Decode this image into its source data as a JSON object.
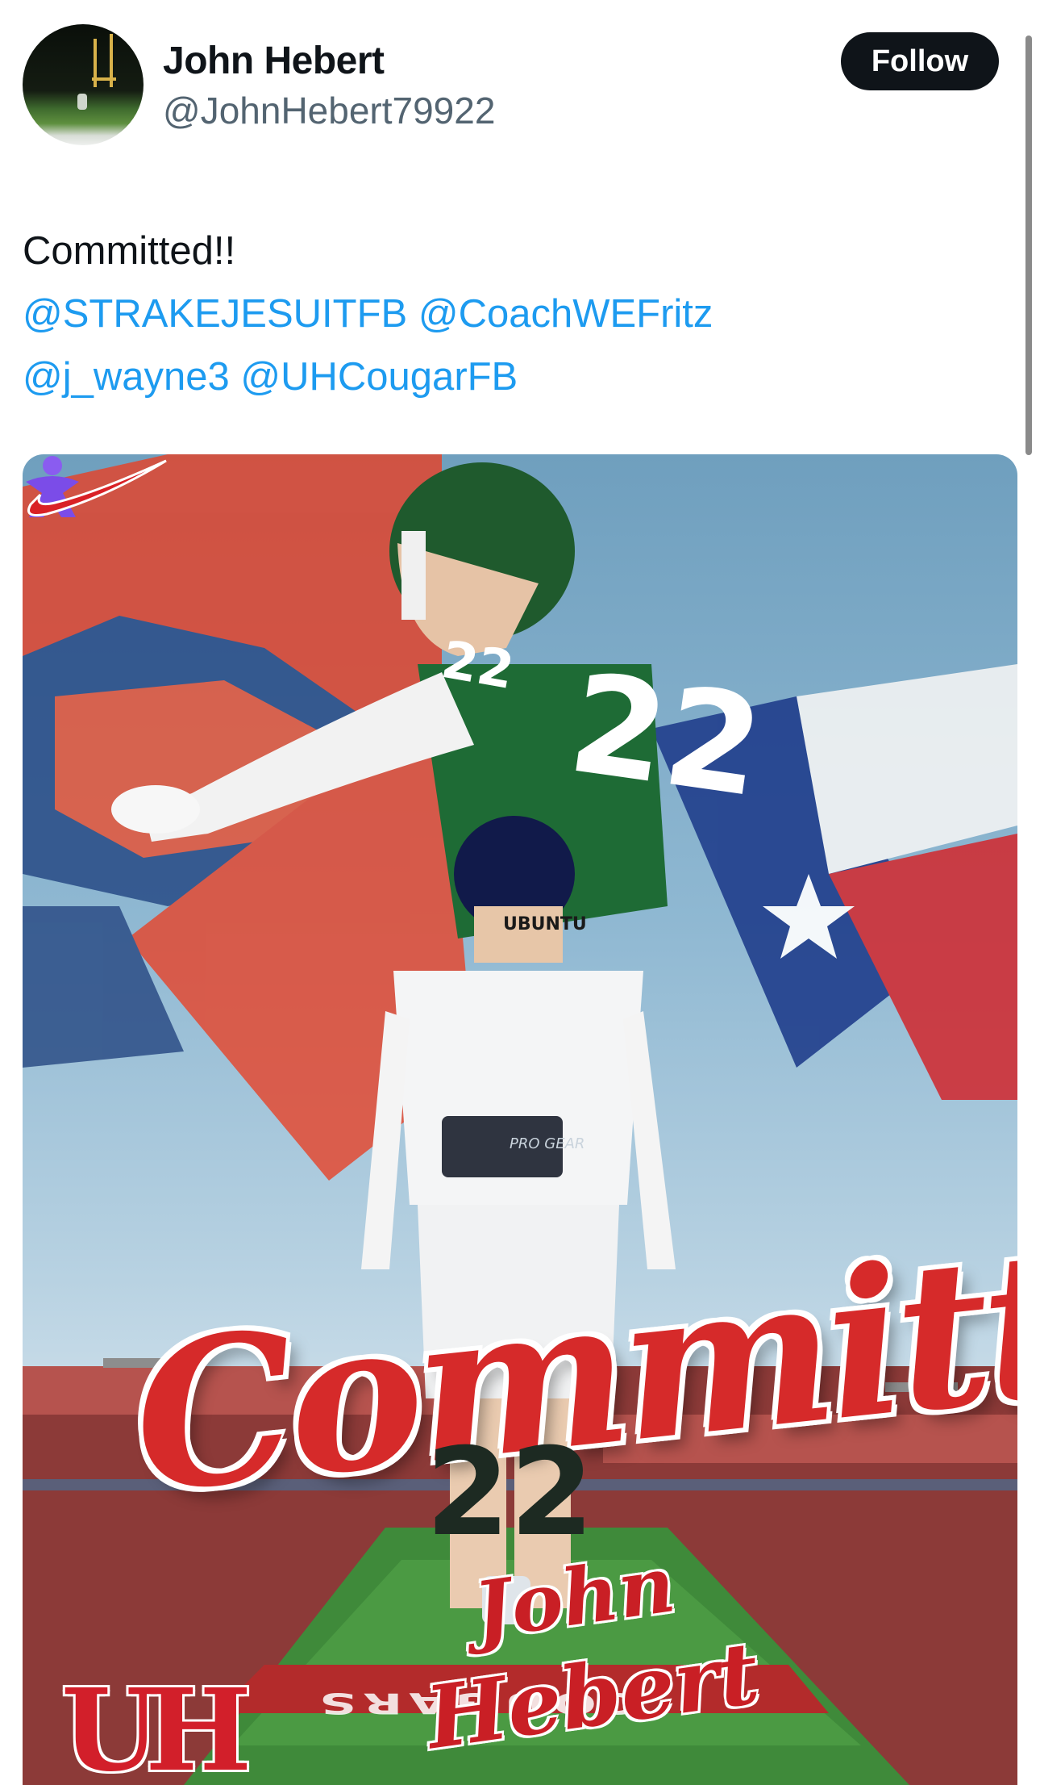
{
  "author": {
    "name": "John Hebert",
    "handle": "@JohnHebert79922",
    "avatar_icon": "football-field-avatar"
  },
  "follow_button": {
    "label": "Follow"
  },
  "post": {
    "text": "Committed!!",
    "mentions": [
      "@STRAKEJESUITFB",
      "@CoachWEFritz",
      "@j_wayne3",
      "@UHCougarFB"
    ]
  },
  "media": {
    "headline": "Committed",
    "player_first_name": "John",
    "player_last_name": "Hebert",
    "jersey_number": "22",
    "jersey_nameplate": "UBUNTU",
    "belt_text": "PRO GEAR",
    "endzone_text": "COUGARS",
    "school_logo": "UH",
    "colors": {
      "uh_red": "#c8102e",
      "jersey_green": "#1e6b35",
      "texas_blue": "#1f3f8f",
      "sky": "#8fb8d2",
      "field_green": "#3f8a3a",
      "app_icon_purple": "#7b4ce8"
    },
    "icons": [
      "app-logo-icon",
      "nike-swoosh-icon",
      "uh-logo-icon"
    ]
  }
}
